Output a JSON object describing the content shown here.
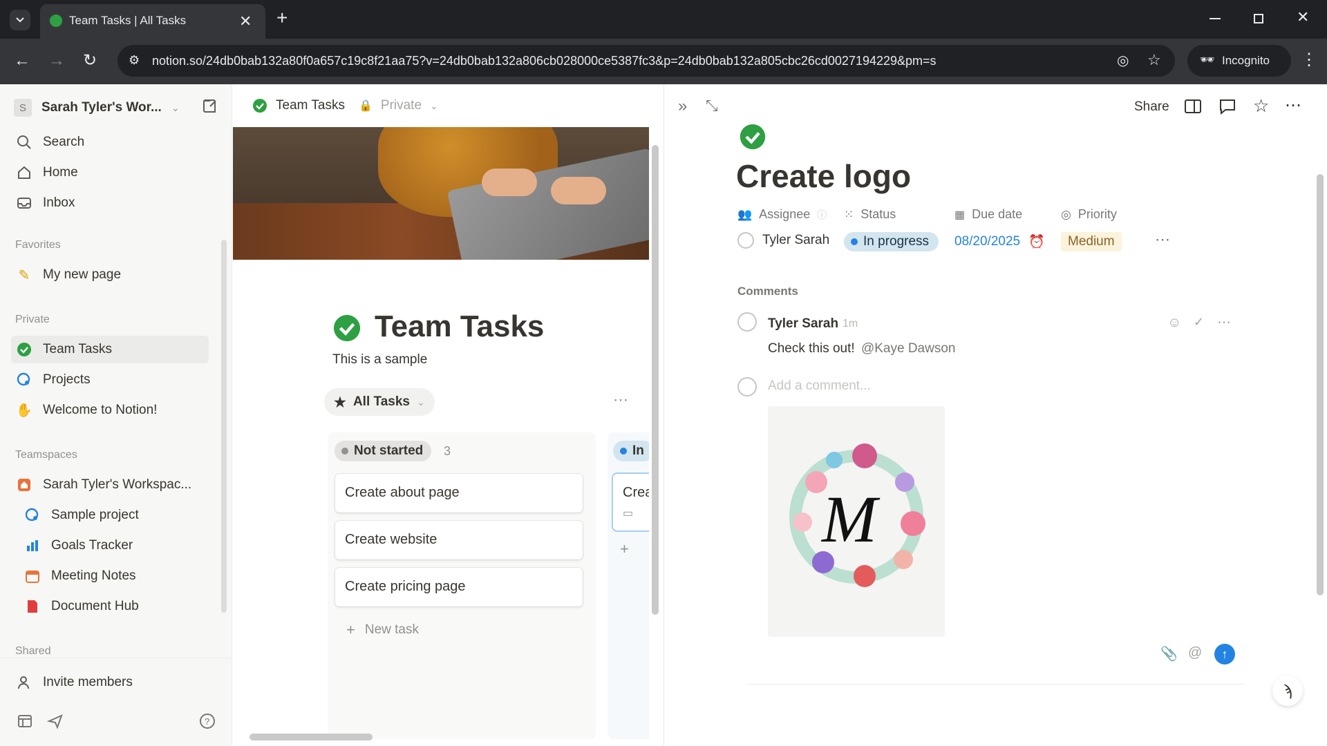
{
  "browser": {
    "tab_title": "Team Tasks | All Tasks",
    "url": "notion.so/24db0bab132a80f0a657c19c8f21aa75?v=24db0bab132a806cb028000ce5387fc3&p=24db0bab132a805cbc26cd0027194229&pm=s",
    "incognito_label": "Incognito"
  },
  "sidebar": {
    "workspace_initial": "S",
    "workspace_name": "Sarah Tyler's Wor...",
    "nav": [
      {
        "label": "Search",
        "icon": "search-icon"
      },
      {
        "label": "Home",
        "icon": "home-icon"
      },
      {
        "label": "Inbox",
        "icon": "inbox-icon"
      }
    ],
    "favorites_title": "Favorites",
    "favorites": [
      {
        "label": "My new page",
        "icon": "pencil-icon"
      }
    ],
    "private_title": "Private",
    "private": [
      {
        "label": "Team Tasks",
        "icon": "check-circle-icon"
      },
      {
        "label": "Projects",
        "icon": "projects-icon"
      },
      {
        "label": "Welcome to Notion!",
        "icon": "wave-icon"
      }
    ],
    "teamspaces_title": "Teamspaces",
    "teamspaces": [
      {
        "label": "Sarah Tyler's Workspac...",
        "icon": "house-icon"
      },
      {
        "label": "Sample project",
        "icon": "projects-icon"
      },
      {
        "label": "Goals Tracker",
        "icon": "chart-icon"
      },
      {
        "label": "Meeting Notes",
        "icon": "calendar-icon"
      },
      {
        "label": "Document Hub",
        "icon": "document-icon"
      }
    ],
    "shared_title": "Shared",
    "invite_label": "Invite members"
  },
  "middle": {
    "breadcrumb_page": "Team Tasks",
    "breadcrumb_privacy": "Private",
    "page_title": "Team Tasks",
    "page_description": "This is a sample",
    "view_name": "All Tasks",
    "column_status": "Not started",
    "column_count": "3",
    "cards": [
      "Create about page",
      "Create website",
      "Create pricing page"
    ],
    "new_task_label": "New task",
    "next_column_status": "In",
    "next_column_card": "Crea"
  },
  "detail": {
    "share_label": "Share",
    "title": "Create logo",
    "properties": {
      "assignee_label": "Assignee",
      "status_label": "Status",
      "due_label": "Due date",
      "priority_label": "Priority",
      "assignee_value": "Tyler Sarah",
      "status_value": "In progress",
      "due_value": "08/20/2025",
      "priority_value": "Medium"
    },
    "comments_heading": "Comments",
    "comment": {
      "author": "Tyler Sarah",
      "time": "1m",
      "text": "Check this out!",
      "mention": "@Kaye Dawson"
    },
    "add_comment_placeholder": "Add a comment...",
    "attachment_letter": "M"
  },
  "colors": {
    "accent_green": "#2ea043",
    "status_blue": "#2383e2",
    "priority_bg": "#fbf3db",
    "priority_text": "#89632a"
  }
}
